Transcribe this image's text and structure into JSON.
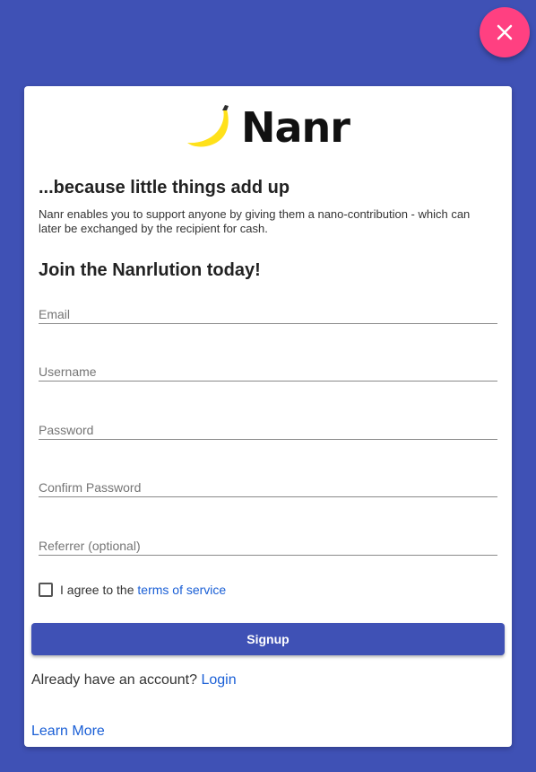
{
  "close_button": {
    "icon": "close-icon",
    "color": "#ff4081"
  },
  "brand": {
    "name": "Nanr",
    "logo": "banana-icon",
    "accent": "#ffe11a"
  },
  "tagline": "...because little things add up",
  "description": "Nanr enables you to support anyone by giving them a nano-contribution - which can later be exchanged by the recipient for cash.",
  "join_heading": "Join the Nanrlution today!",
  "form": {
    "email": {
      "placeholder": "Email",
      "value": ""
    },
    "username": {
      "placeholder": "Username",
      "value": ""
    },
    "password": {
      "placeholder": "Password",
      "value": ""
    },
    "confirm_password": {
      "placeholder": "Confirm Password",
      "value": ""
    },
    "referrer": {
      "placeholder": "Referrer (optional)",
      "value": ""
    }
  },
  "agree": {
    "prefix": "I agree to the ",
    "link": "terms of service",
    "checked": false
  },
  "signup_label": "Signup",
  "login_prompt": {
    "text": "Already have an account? ",
    "link": "Login"
  },
  "learn_more": "Learn More",
  "colors": {
    "primary": "#3f51b5",
    "link": "#1a5fd6"
  }
}
